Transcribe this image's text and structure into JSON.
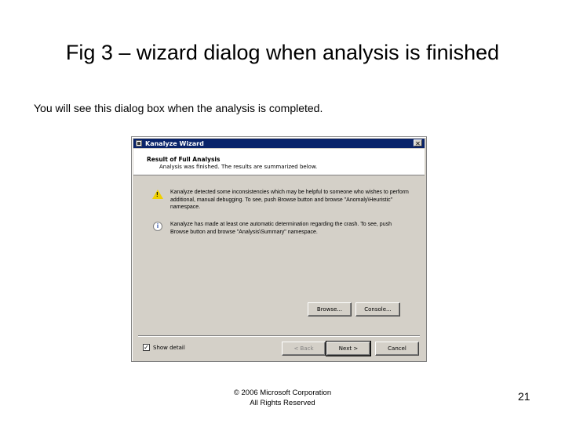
{
  "slide": {
    "title": "Fig 3 – wizard dialog when analysis is finished",
    "body_text": "You will see this dialog box when the analysis is completed.",
    "footer_line1": "© 2006 Microsoft Corporation",
    "footer_line2": "All Rights Reserved",
    "page_number": "21"
  },
  "dialog": {
    "window_title": "Kanalyze Wizard",
    "close_glyph": "✕",
    "header_title": "Result of Full Analysis",
    "header_subtitle": "Analysis was finished. The results are summarized below.",
    "messages": [
      {
        "icon": "warning-icon",
        "text": "Kanalyze detected some inconsistencies which may be helpful to someone who wishes to perform additional, manual debugging. To see, push Browse button and browse \"Anomaly\\Heuristic\" namespace."
      },
      {
        "icon": "info-icon",
        "text": "Kanalyze has made at least one automatic determination regarding the crash. To see, push Browse button and browse \"Analysis\\Summary\" namespace."
      }
    ],
    "browse_button": "Browse...",
    "console_button": "Console...",
    "show_details_label": "Show detail",
    "show_details_checked": "✓",
    "back_button": "< Back",
    "next_button": "Next >",
    "cancel_button": "Cancel"
  }
}
